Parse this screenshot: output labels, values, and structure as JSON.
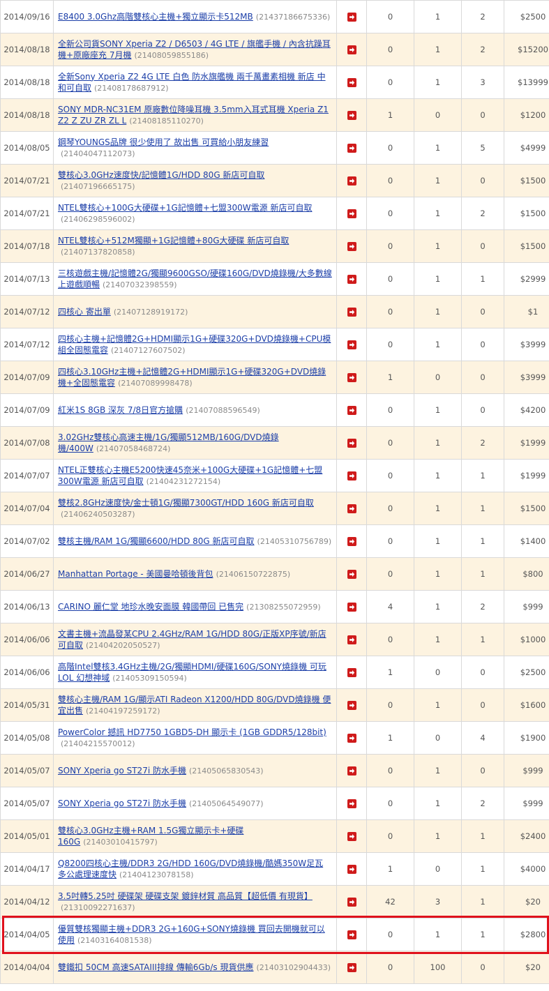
{
  "highlight_color": "#e0111c",
  "arrow_icon": "red-arrow-right-icon",
  "rows": [
    {
      "date": "2014/09/16",
      "title": "E8400 3.0Ghz高階雙核心主機+獨立顯示卡512MB",
      "id": "(21437186675336)",
      "v1": "0",
      "v2": "1",
      "v3": "2",
      "price": "$2500"
    },
    {
      "date": "2014/08/18",
      "title": "全新公司貨SONY Xperia Z2 / D6503 / 4G LTE / 旗艦手機 / 內含抗躁耳機+原廠座充 7月機",
      "id": "(21408059855186)",
      "v1": "0",
      "v2": "1",
      "v3": "2",
      "price": "$15200"
    },
    {
      "date": "2014/08/18",
      "title": "全新Sony Xperia Z2 4G LTE 白色 防水旗艦機 兩千萬畫素相機 新店 中和可自取",
      "id": "(21408178687912)",
      "v1": "0",
      "v2": "1",
      "v3": "3",
      "price": "$13999"
    },
    {
      "date": "2014/08/18",
      "title": "SONY MDR-NC31EM 原廠數位降噪耳機 3.5mm入耳式耳機 Xperia Z1 Z2 Z ZU ZR ZL L",
      "id": "(21408185110270)",
      "v1": "1",
      "v2": "0",
      "v3": "0",
      "price": "$1200"
    },
    {
      "date": "2014/08/05",
      "title": "鋼琴YOUNGS品牌 很少使用了 故出售 可買給小朋友練習",
      "id": "(21404047112073)",
      "v1": "0",
      "v2": "1",
      "v3": "5",
      "price": "$4999"
    },
    {
      "date": "2014/07/21",
      "title": "雙核心3.0GHz速度快/記憶體1G/HDD 80G 新店可自取",
      "id": "(21407196665175)",
      "v1": "0",
      "v2": "1",
      "v3": "0",
      "price": "$1500"
    },
    {
      "date": "2014/07/21",
      "title": "NTEL雙核心+100G大硬碟+1G記憶體+七盟300W電源 新店可自取",
      "id": "(21406298596002)",
      "v1": "0",
      "v2": "1",
      "v3": "2",
      "price": "$1500"
    },
    {
      "date": "2014/07/18",
      "title": "NTEL雙核心+512M獨顯+1G記憶體+80G大硬碟 新店可自取",
      "id": "(21407137820858)",
      "v1": "0",
      "v2": "1",
      "v3": "0",
      "price": "$1500"
    },
    {
      "date": "2014/07/13",
      "title": "三核遊戲主機/記憶體2G/獨顯9600GSO/硬碟160G/DVD燒錄機/大多數線上遊戲順暢",
      "id": "(21407032398559)",
      "v1": "0",
      "v2": "1",
      "v3": "1",
      "price": "$2999"
    },
    {
      "date": "2014/07/12",
      "title": "四核心 寄出單",
      "id": "(21407128919172)",
      "v1": "0",
      "v2": "1",
      "v3": "0",
      "price": "$1"
    },
    {
      "date": "2014/07/12",
      "title": "四核心主機+記憶體2G+HDMI顯示1G+硬碟320G+DVD燒錄機+CPU模組全固態電容",
      "id": "(21407127607502)",
      "v1": "0",
      "v2": "1",
      "v3": "0",
      "price": "$3999"
    },
    {
      "date": "2014/07/09",
      "title": "四核心3.10GHz主機+記憶體2G+HDMI顯示1G+硬碟320G+DVD燒錄機+全固態電容",
      "id": "(21407089998478)",
      "v1": "1",
      "v2": "0",
      "v3": "0",
      "price": "$3999"
    },
    {
      "date": "2014/07/09",
      "title": "紅米1S 8GB 深灰 7/8日官方搶購",
      "id": "(21407088596549)",
      "v1": "0",
      "v2": "1",
      "v3": "0",
      "price": "$4200"
    },
    {
      "date": "2014/07/08",
      "title": "3.02GHz雙核心高速主機/1G/獨顯512MB/160G/DVD燒錄機/400W",
      "id": "(21407058468724)",
      "v1": "0",
      "v2": "1",
      "v3": "2",
      "price": "$1999"
    },
    {
      "date": "2014/07/07",
      "title": "NTEL正雙核心主機E5200快速45奈米+100G大硬碟+1G記憶體+七盟300W電源 新店可自取",
      "id": "(21404231272154)",
      "v1": "0",
      "v2": "1",
      "v3": "1",
      "price": "$1999"
    },
    {
      "date": "2014/07/04",
      "title": "雙核2.8GHz速度快/金士頓1G/獨顯7300GT/HDD 160G 新店可自取",
      "id": "(21406240503287)",
      "v1": "0",
      "v2": "1",
      "v3": "1",
      "price": "$1500"
    },
    {
      "date": "2014/07/02",
      "title": "雙核主機/RAM 1G/獨顯6600/HDD 80G 新店可自取",
      "id": "(21405310756789)",
      "v1": "0",
      "v2": "1",
      "v3": "1",
      "price": "$1400"
    },
    {
      "date": "2014/06/27",
      "title": "Manhattan Portage - 美國曼哈頓後背包",
      "id": "(21406150722875)",
      "v1": "0",
      "v2": "1",
      "v3": "1",
      "price": "$800"
    },
    {
      "date": "2014/06/13",
      "title": "CARINO 麗仁堂 地珍水晚安面膜 韓國帶回 已售完",
      "id": "(21308255072959)",
      "v1": "4",
      "v2": "1",
      "v3": "2",
      "price": "$999"
    },
    {
      "date": "2014/06/06",
      "title": "文書主機+流晶發某CPU 2.4GHz/RAM 1G/HDD 80G/正版XP序號/新店可自取",
      "id": "(21404202050527)",
      "v1": "0",
      "v2": "1",
      "v3": "1",
      "price": "$1000"
    },
    {
      "date": "2014/06/06",
      "title": "高階Intel雙核3.4GHz主機/2G/獨顯HDMI/硬碟160G/SONY燒錄機 可玩LOL 幻想神域",
      "id": "(21405309150594)",
      "v1": "1",
      "v2": "0",
      "v3": "0",
      "price": "$2500"
    },
    {
      "date": "2014/05/31",
      "title": "雙核心主機/RAM 1G/顯示ATI Radeon X1200/HDD 80G/DVD燒錄機 便宜出售",
      "id": "(21404197259172)",
      "v1": "0",
      "v2": "1",
      "v3": "0",
      "price": "$1600"
    },
    {
      "date": "2014/05/08",
      "title": "PowerColor 撼訊 HD7750 1GBD5-DH 顯示卡 (1GB GDDR5/128bit)",
      "id": "(21404215570012)",
      "v1": "1",
      "v2": "0",
      "v3": "4",
      "price": "$1900"
    },
    {
      "date": "2014/05/07",
      "title": "SONY Xperia go ST27i 防水手機",
      "id": "(21405065830543)",
      "v1": "0",
      "v2": "1",
      "v3": "0",
      "price": "$999"
    },
    {
      "date": "2014/05/07",
      "title": "SONY Xperia go ST27i 防水手機",
      "id": "(21405064549077)",
      "v1": "0",
      "v2": "1",
      "v3": "2",
      "price": "$999"
    },
    {
      "date": "2014/05/01",
      "title": "雙核心3.0GHz主機+RAM 1.5G獨立顯示卡+硬碟160G",
      "id": "(21403010415797)",
      "v1": "0",
      "v2": "1",
      "v3": "1",
      "price": "$2400"
    },
    {
      "date": "2014/04/17",
      "title": "Q8200四核心主機/DDR3 2G/HDD 160G/DVD燒錄機/酷媽350W足瓦 多公處理速度快",
      "id": "(21404123078158)",
      "v1": "1",
      "v2": "0",
      "v3": "1",
      "price": "$4000"
    },
    {
      "date": "2014/04/12",
      "title": "3.5吋轉5.25吋 硬碟架 硬碟支架 鍍鋅材質 高品質【超低價 有現貨】",
      "id": "(21310092271637)",
      "v1": "42",
      "v2": "3",
      "v3": "1",
      "price": "$20"
    },
    {
      "date": "2014/04/05",
      "title": "優質雙核獨顯主機+DDR3 2G+160G+SONY燒錄機 買回去開機就可以使用",
      "id": "(21403164081538)",
      "v1": "0",
      "v2": "1",
      "v3": "1",
      "price": "$2800"
    },
    {
      "date": "2014/04/04",
      "title": "雙鐵扣 50CM 高速SATAIII排線 傳輸6Gb/s 現貨供應",
      "id": "(21403102904433)",
      "v1": "0",
      "v2": "100",
      "v3": "0",
      "price": "$20"
    }
  ]
}
